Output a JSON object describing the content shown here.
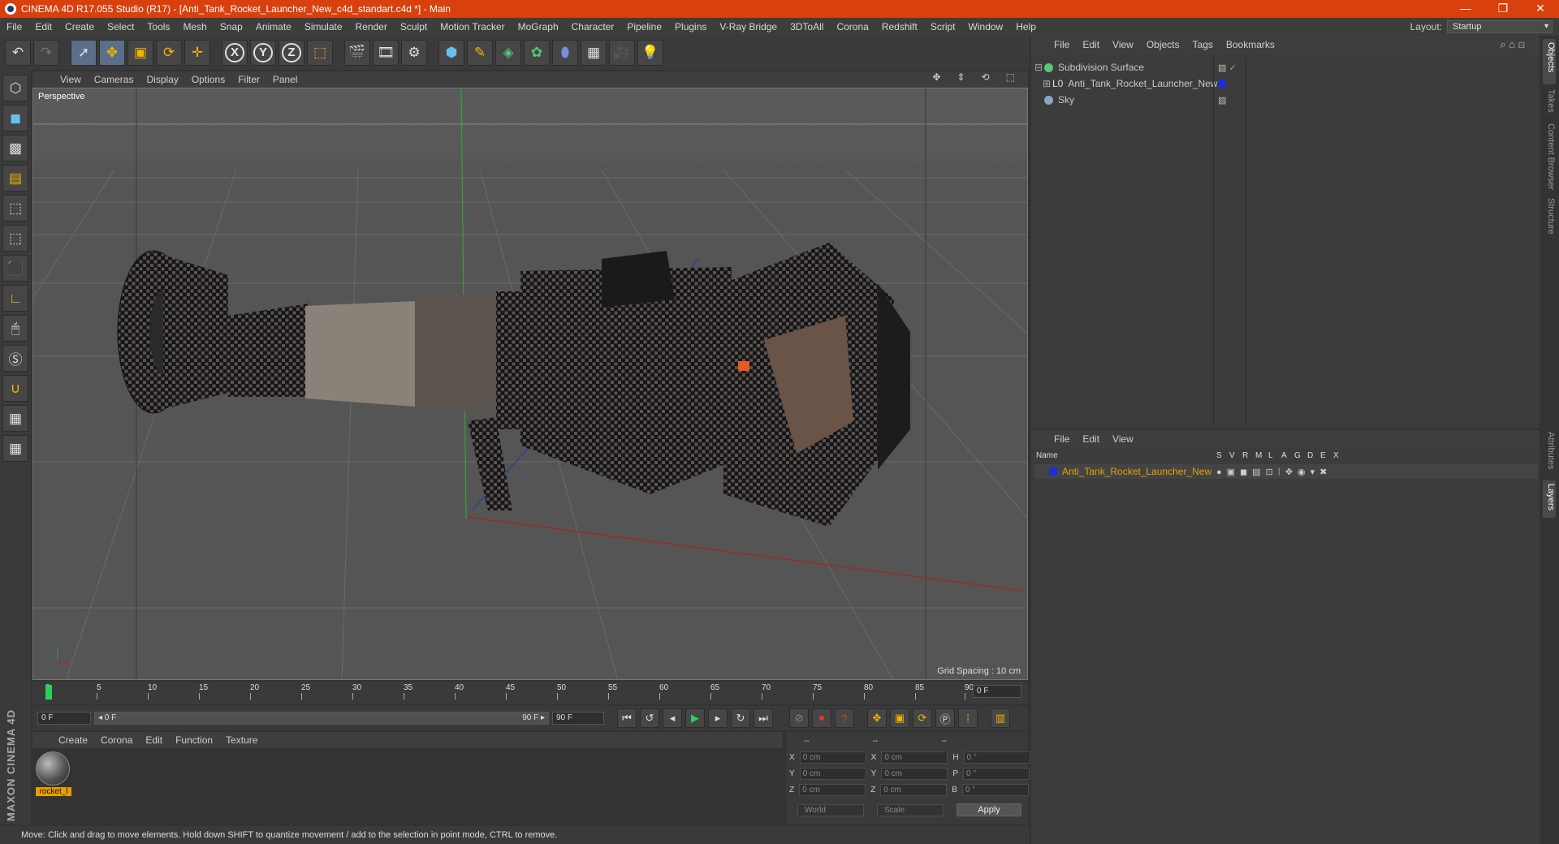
{
  "titlebar": {
    "text": "CINEMA 4D R17.055 Studio (R17) - [Anti_Tank_Rocket_Launcher_New_c4d_standart.c4d *] - Main",
    "minimize": "—",
    "restore": "❐",
    "close": "✕"
  },
  "menu": [
    "File",
    "Edit",
    "Create",
    "Select",
    "Tools",
    "Mesh",
    "Snap",
    "Animate",
    "Simulate",
    "Render",
    "Sculpt",
    "Motion Tracker",
    "MoGraph",
    "Character",
    "Pipeline",
    "Plugins",
    "V-Ray Bridge",
    "3DToAll",
    "Corona",
    "Redshift",
    "Script",
    "Window",
    "Help"
  ],
  "layout": {
    "label": "Layout:",
    "value": "Startup"
  },
  "viewport": {
    "menu": [
      "View",
      "Cameras",
      "Display",
      "Options",
      "Filter",
      "Panel"
    ],
    "label": "Perspective",
    "grid_spacing": "Grid Spacing : 10 cm"
  },
  "timeline": {
    "ticks": [
      "0",
      "5",
      "10",
      "15",
      "20",
      "25",
      "30",
      "35",
      "40",
      "45",
      "50",
      "55",
      "60",
      "65",
      "70",
      "75",
      "80",
      "85",
      "90"
    ],
    "end_field": "0 F",
    "start": "0 F",
    "range_start": "◂ 0 F",
    "range_end": "90 F ▸",
    "max": "90 F"
  },
  "material": {
    "menu": [
      "Create",
      "Corona",
      "Edit",
      "Function",
      "Texture"
    ],
    "name": "rocket_l"
  },
  "coords": {
    "headers": [
      "--",
      "--",
      "--"
    ],
    "rows": [
      {
        "a": "X",
        "av": "0 cm",
        "b": "X",
        "bv": "0 cm",
        "c": "H",
        "cv": "0 °"
      },
      {
        "a": "Y",
        "av": "0 cm",
        "b": "Y",
        "bv": "0 cm",
        "c": "P",
        "cv": "0 °"
      },
      {
        "a": "Z",
        "av": "0 cm",
        "b": "Z",
        "bv": "0 cm",
        "c": "B",
        "cv": "0 °"
      }
    ],
    "mode": "World",
    "scale": "Scale",
    "apply": "Apply"
  },
  "maxon": "MAXON CINEMA 4D",
  "status": "Move: Click and drag to move elements. Hold down SHIFT to quantize movement / add to the selection in point mode, CTRL to remove.",
  "objects": {
    "menu": [
      "File",
      "Edit",
      "View",
      "Objects",
      "Tags",
      "Bookmarks"
    ],
    "items": [
      {
        "name": "Subdivision Surface",
        "color": "#54c77a"
      },
      {
        "name": "Anti_Tank_Rocket_Launcher_New",
        "color": "#1c2fd0"
      },
      {
        "name": "Sky",
        "color": "#8aa4c8"
      }
    ]
  },
  "layers": {
    "menu": [
      "File",
      "Edit",
      "View"
    ],
    "header_name": "Name",
    "flags": [
      "S",
      "V",
      "R",
      "M",
      "L",
      "A",
      "G",
      "D",
      "E",
      "X"
    ],
    "row": {
      "name": "Anti_Tank_Rocket_Launcher_New",
      "color": "#e8a000"
    }
  },
  "side_tabs": [
    "Objects",
    "Takes",
    "Content Browser",
    "Structure",
    "Attributes",
    "Layers"
  ]
}
